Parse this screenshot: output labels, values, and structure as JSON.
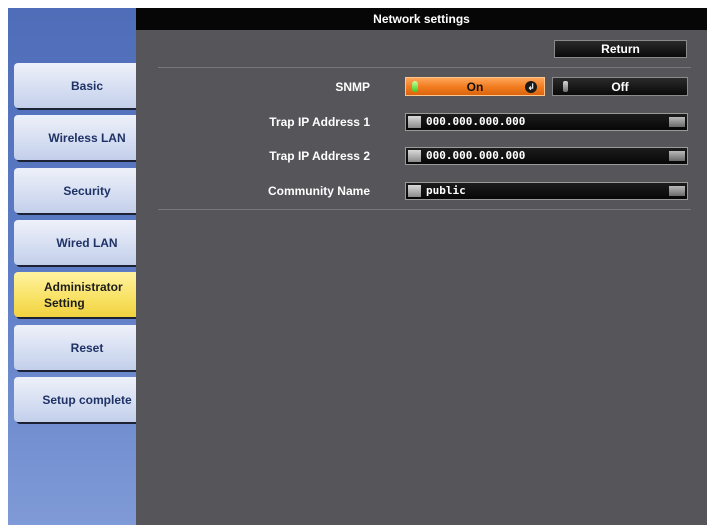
{
  "sidebar": {
    "items": [
      {
        "label": "Basic",
        "active": false
      },
      {
        "label": "Wireless LAN",
        "active": false
      },
      {
        "label": "Security",
        "active": false
      },
      {
        "label": "Wired LAN",
        "active": false
      },
      {
        "label_line1": "Administrator",
        "label_line2": "Setting",
        "active": true
      },
      {
        "label": "Reset",
        "active": false
      },
      {
        "label": "Setup complete",
        "active": false
      }
    ]
  },
  "header": {
    "title": "Network settings"
  },
  "toolbar": {
    "return_label": "Return"
  },
  "form": {
    "snmp": {
      "label": "SNMP",
      "on_label": "On",
      "off_label": "Off",
      "selected": "On"
    },
    "trap_ip_1": {
      "label": "Trap IP Address 1",
      "value": "000.000.000.000"
    },
    "trap_ip_2": {
      "label": "Trap IP Address 2",
      "value": "000.000.000.000"
    },
    "community_name": {
      "label": "Community Name",
      "value": "public"
    }
  },
  "colors": {
    "active_tab": "#f8e162",
    "toggle_on": "#f07a1c",
    "panel_bg": "#55555a",
    "sidebar_bg": "#5d7cc6"
  }
}
